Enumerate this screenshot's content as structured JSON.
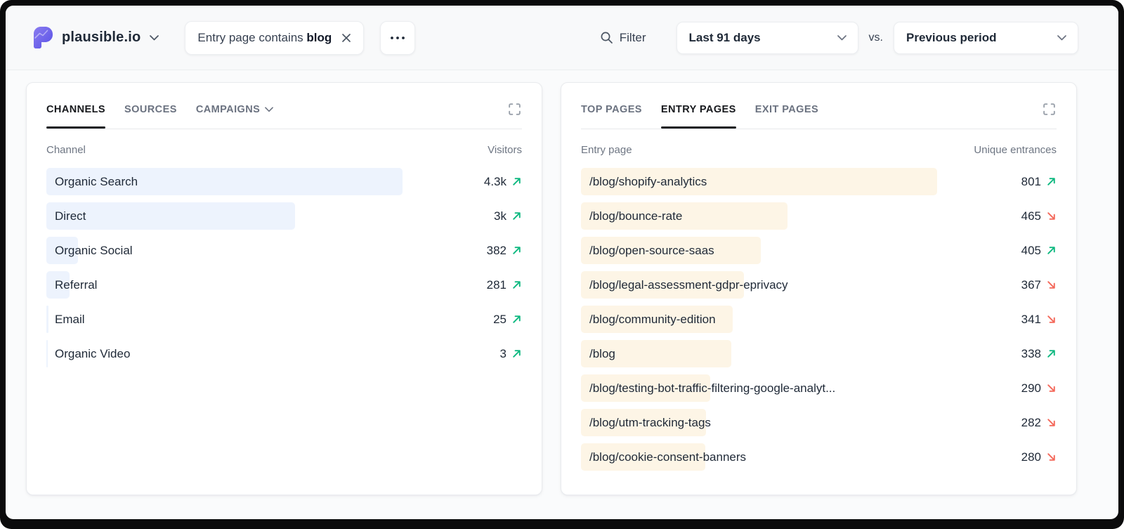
{
  "header": {
    "site": "plausible.io",
    "filter_chip": {
      "prefix": "Entry page contains ",
      "value": "blog"
    },
    "filter_label": "Filter",
    "date_range": "Last 91 days",
    "vs_label": "vs.",
    "comparison": "Previous period"
  },
  "colors": {
    "brand_gradient_start": "#8b7df0",
    "brand_gradient_end": "#5850e6",
    "trend_up": "#10b981",
    "trend_down": "#f4695b",
    "left_bar": "#edf3fd",
    "right_bar": "#fdf5e6"
  },
  "icons": {
    "logo": "plausible-logo",
    "chevron": "chevron-down",
    "close": "x-mark",
    "more": "ellipsis",
    "search": "magnifier",
    "expand": "fullscreen-corners",
    "trend_up": "arrow-up-right",
    "trend_down": "arrow-down-right"
  },
  "left_panel": {
    "tabs": [
      {
        "label": "CHANNELS",
        "active": true
      },
      {
        "label": "SOURCES",
        "active": false
      },
      {
        "label": "CAMPAIGNS",
        "active": false,
        "has_chevron": true
      }
    ],
    "col_key": "Channel",
    "col_value": "Visitors",
    "max_value": 4300,
    "rows": [
      {
        "label": "Organic Search",
        "display": "4.3k",
        "raw": 4300,
        "trend": "up"
      },
      {
        "label": "Direct",
        "display": "3k",
        "raw": 3000,
        "trend": "up"
      },
      {
        "label": "Organic Social",
        "display": "382",
        "raw": 382,
        "trend": "up"
      },
      {
        "label": "Referral",
        "display": "281",
        "raw": 281,
        "trend": "up"
      },
      {
        "label": "Email",
        "display": "25",
        "raw": 25,
        "trend": "up"
      },
      {
        "label": "Organic Video",
        "display": "3",
        "raw": 3,
        "trend": "up"
      }
    ]
  },
  "right_panel": {
    "tabs": [
      {
        "label": "TOP PAGES",
        "active": false
      },
      {
        "label": "ENTRY PAGES",
        "active": true
      },
      {
        "label": "EXIT PAGES",
        "active": false
      }
    ],
    "col_key": "Entry page",
    "col_value": "Unique entrances",
    "max_value": 801,
    "rows": [
      {
        "label": "/blog/shopify-analytics",
        "display": "801",
        "raw": 801,
        "trend": "up"
      },
      {
        "label": "/blog/bounce-rate",
        "display": "465",
        "raw": 465,
        "trend": "down"
      },
      {
        "label": "/blog/open-source-saas",
        "display": "405",
        "raw": 405,
        "trend": "up"
      },
      {
        "label": "/blog/legal-assessment-gdpr-eprivacy",
        "display": "367",
        "raw": 367,
        "trend": "down"
      },
      {
        "label": "/blog/community-edition",
        "display": "341",
        "raw": 341,
        "trend": "down"
      },
      {
        "label": "/blog",
        "display": "338",
        "raw": 338,
        "trend": "up"
      },
      {
        "label": "/blog/testing-bot-traffic-filtering-google-analyt...",
        "display": "290",
        "raw": 290,
        "trend": "down"
      },
      {
        "label": "/blog/utm-tracking-tags",
        "display": "282",
        "raw": 282,
        "trend": "down"
      },
      {
        "label": "/blog/cookie-consent-banners",
        "display": "280",
        "raw": 280,
        "trend": "down"
      }
    ]
  }
}
